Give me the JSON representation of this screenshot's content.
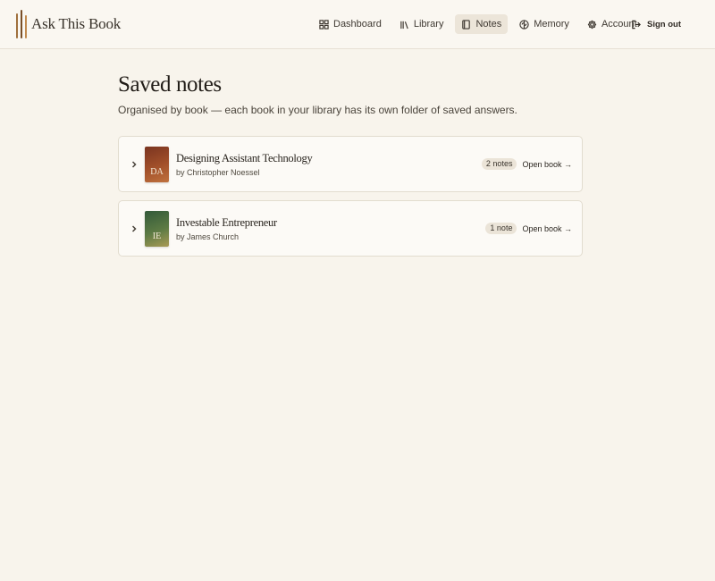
{
  "app": {
    "name": "Ask This Book"
  },
  "nav": {
    "items": [
      {
        "label": "Dashboard",
        "icon": "grid-icon",
        "active": false
      },
      {
        "label": "Library",
        "icon": "library-icon",
        "active": false
      },
      {
        "label": "Notes",
        "icon": "notebook-icon",
        "active": true
      },
      {
        "label": "Memory",
        "icon": "brain-icon",
        "active": false
      },
      {
        "label": "Account",
        "icon": "gear-icon",
        "active": false
      }
    ],
    "signout_label": "Sign out"
  },
  "page": {
    "title": "Saved notes",
    "subtitle": "Organised by book — each book in your library has its own folder of saved answers."
  },
  "books": [
    {
      "title": "Designing Assistant Technology",
      "author": "by Christopher Noessel",
      "cover_initials": "DA",
      "notes_count": "2 notes",
      "open_label": "Open book →"
    },
    {
      "title": "Investable Entrepreneur",
      "author": "by James Church",
      "cover_initials": "IE",
      "notes_count": "1 note",
      "open_label": "Open book →"
    }
  ],
  "colors": {
    "background": "#f8f4ec",
    "active_nav": "#ece5d9",
    "accent_brown": "#7a4f27"
  }
}
